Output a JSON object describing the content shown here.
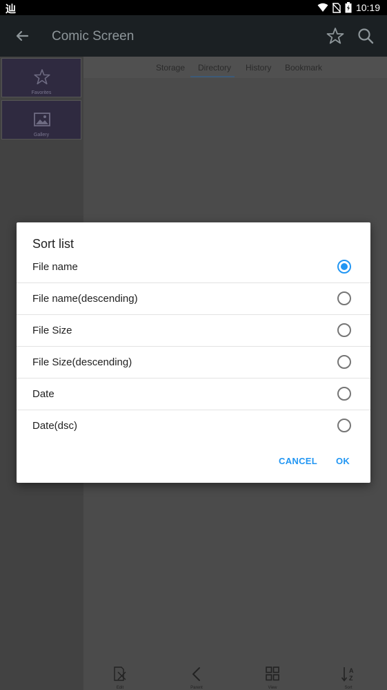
{
  "status_bar": {
    "app_glyph": "辿",
    "time": "10:19",
    "icons": [
      "wifi-icon",
      "no-sim-icon",
      "battery-charging-icon"
    ]
  },
  "app_bar": {
    "title": "Comic Screen",
    "icons": [
      "back-arrow-icon",
      "star-icon",
      "search-icon"
    ]
  },
  "sidebar": {
    "items": [
      {
        "label": "Favorites",
        "icon": "star-outline-icon"
      },
      {
        "label": "Gallery",
        "icon": "image-icon"
      }
    ]
  },
  "tabs": [
    {
      "label": "Storage"
    },
    {
      "label": "Directory",
      "active": true
    },
    {
      "label": "History"
    },
    {
      "label": "Bookmark"
    }
  ],
  "bottom_bar": {
    "items": [
      {
        "label": "Edit",
        "icon": "edit-icon"
      },
      {
        "label": "Parent",
        "icon": "chevron-left-icon"
      },
      {
        "label": "View",
        "icon": "grid-icon"
      },
      {
        "label": "Sort",
        "icon": "sort-az-icon"
      }
    ]
  },
  "dialog": {
    "title": "Sort list",
    "options": [
      {
        "label": "File name",
        "selected": true
      },
      {
        "label": "File name(descending)",
        "selected": false
      },
      {
        "label": "File Size",
        "selected": false
      },
      {
        "label": "File Size(descending)",
        "selected": false
      },
      {
        "label": "Date",
        "selected": false
      },
      {
        "label": "Date(dsc)",
        "selected": false
      }
    ],
    "cancel_label": "CANCEL",
    "ok_label": "OK"
  },
  "colors": {
    "accent": "#2196f3",
    "app_bar": "#1b2023",
    "status_bar": "#000000",
    "scrim_background": "#4b4b4b",
    "side_tile": "#2f2a40"
  }
}
